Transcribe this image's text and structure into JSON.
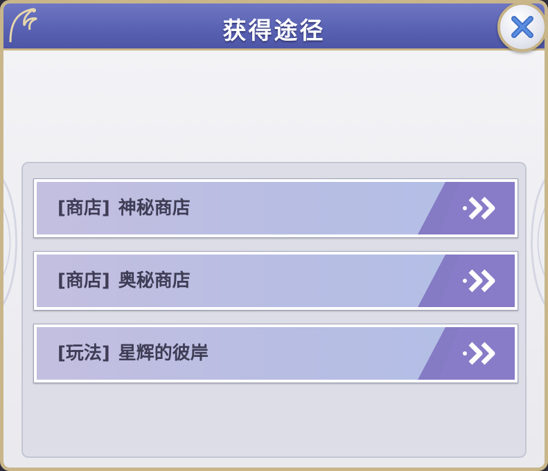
{
  "dialog": {
    "title": "获得途径",
    "close_icon": "close-x-icon"
  },
  "sources": [
    {
      "category": "[商店]",
      "name": "神秘商店",
      "icon": "double-chevron-right-icon"
    },
    {
      "category": "[商店]",
      "name": "奥秘商店",
      "icon": "double-chevron-right-icon"
    },
    {
      "category": "[玩法]",
      "name": "星辉的彼岸",
      "icon": "double-chevron-right-icon"
    }
  ],
  "colors": {
    "title_bar": "#5a62b3",
    "frame_gold": "#c8b68a",
    "item_gradient_start": "#c3bfe0",
    "item_gradient_end": "#b3c0e8",
    "arrow_zone": "#7d6fbd",
    "close_x": "#3f6fc4"
  }
}
